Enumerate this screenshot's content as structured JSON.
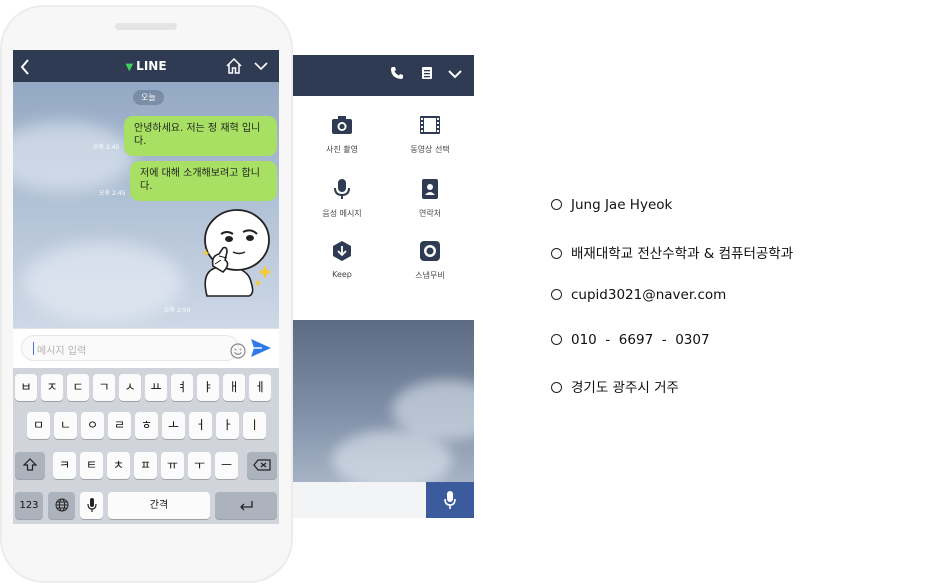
{
  "chat": {
    "app_title": "LINE",
    "date_chip": "오늘",
    "messages": [
      {
        "text": "안녕하세요. 저는 정 재혁 입니다.",
        "time": "오후 2:45"
      },
      {
        "text": "저에 대해 소개해보려고 합니다.",
        "time": "오후 2:45"
      }
    ],
    "sticker_time": "오후 2:50",
    "input_placeholder": "메시지 입력"
  },
  "attach_menu": {
    "items": [
      {
        "label": "사진 촬영",
        "icon": "camera-icon"
      },
      {
        "label": "동영상 선택",
        "icon": "film-icon"
      },
      {
        "label": "음성 메시지",
        "icon": "mic-icon"
      },
      {
        "label": "연락처",
        "icon": "contact-icon"
      },
      {
        "label": "Keep",
        "icon": "keep-icon"
      },
      {
        "label": "스냅무비",
        "icon": "snapmovie-icon"
      }
    ]
  },
  "keyboard": {
    "row1": [
      "ㅂ",
      "ㅈ",
      "ㄷ",
      "ㄱ",
      "ㅅ",
      "ㅛ",
      "ㅕ",
      "ㅑ",
      "ㅐ",
      "ㅔ"
    ],
    "row2": [
      "ㅁ",
      "ㄴ",
      "ㅇ",
      "ㄹ",
      "ㅎ",
      "ㅗ",
      "ㅓ",
      "ㅏ",
      "ㅣ"
    ],
    "row3": [
      "ㅋ",
      "ㅌ",
      "ㅊ",
      "ㅍ",
      "ㅠ",
      "ㅜ",
      "ㅡ"
    ],
    "numbers_key": "123",
    "space_key": "간격"
  },
  "profile": {
    "items": [
      "Jung  Jae  Hyeok",
      "배재대학교 전산수학과 & 컴퓨터공학과",
      "cupid3021@naver.com",
      "010  -  6697  -  0307",
      "경기도 광주시 거주"
    ]
  },
  "colors": {
    "header_navy": "#2f3b52",
    "bubble_green": "#a7e062",
    "send_blue": "#2e7be8",
    "line_green": "#3ad55a"
  }
}
